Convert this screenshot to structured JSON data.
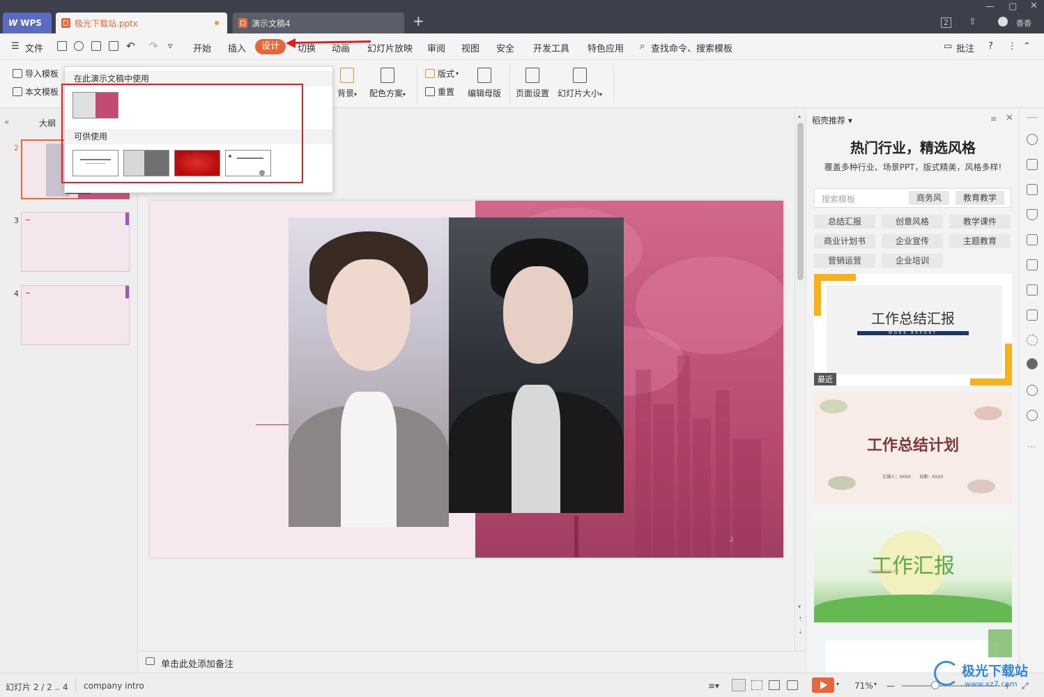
{
  "titlebar": {
    "wps_label": "WPS",
    "tabs": [
      {
        "label": "极光下载站.pptx",
        "active": true
      },
      {
        "label": "演示文稿4",
        "active": false
      }
    ],
    "badge": "2",
    "user_label": "香香"
  },
  "menubar": {
    "file": "文件",
    "items": [
      "开始",
      "插入",
      "设计",
      "切换",
      "动画",
      "幻灯片放映",
      "审阅",
      "视图",
      "安全",
      "开发工具",
      "特色应用"
    ],
    "active": "设计",
    "search": "查找命令、搜索模板",
    "comment": "批注"
  },
  "ribbon": {
    "import_template": "导入模板",
    "this_template": "本文模板",
    "background": "背景",
    "color_scheme": "配色方案",
    "layout": "版式",
    "reset": "重置",
    "edit_master": "编辑母版",
    "page_setup": "页面设置",
    "slide_size": "幻灯片大小"
  },
  "popup": {
    "used_header": "在此演示文稿中使用",
    "available_header": "可供使用"
  },
  "leftpanel": {
    "outline_tab": "大纲",
    "slides": [
      {
        "num": "2",
        "selected": true
      },
      {
        "num": "3",
        "selected": false
      },
      {
        "num": "4",
        "selected": false
      }
    ]
  },
  "slide": {
    "page_num": "2"
  },
  "notes": {
    "placeholder": "单击此处添加备注"
  },
  "rightpanel": {
    "header": "稻壳推荐",
    "title": "热门行业，精选风格",
    "subtitle": "覆盖多种行业、场景PPT，版式精美，风格多样!",
    "search_placeholder": "搜索模板",
    "search_chips": [
      "商务风",
      "教育教学"
    ],
    "chips": [
      "总结汇报",
      "创意风格",
      "教学课件",
      "商业计划书",
      "企业宣传",
      "主题教育",
      "营销运营",
      "企业培训"
    ],
    "cards": [
      {
        "title": "工作总结汇报",
        "sub": "WORK REPORT",
        "badge": "最近"
      },
      {
        "title": "工作总结计划",
        "sub": "汇报人：XXXX　　日期：XXXX"
      },
      {
        "title": "工作汇报",
        "sub": "WORK REPORT"
      }
    ]
  },
  "statusbar": {
    "slide_info": "幻灯片 2 / 2 .. 4",
    "theme_name": "company intro",
    "zoom": "71%"
  },
  "watermark": {
    "text": "极光下载站",
    "url": "www.xz7.com"
  }
}
